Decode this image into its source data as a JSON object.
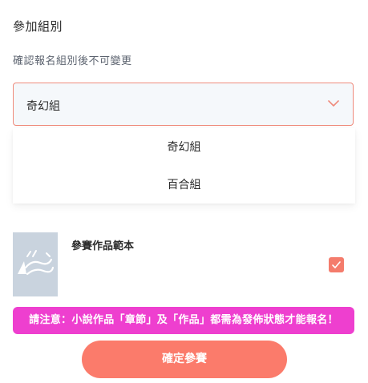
{
  "group_section": {
    "title": "參加組別",
    "note": "確認報名組別後不可變更",
    "selected_value": "奇幻組",
    "options": [
      "奇幻組",
      "百合組"
    ],
    "accent_color": "#ef8a7b",
    "chevron_icon": "chevron-down-icon"
  },
  "work": {
    "title": "參賽作品範本",
    "selected": true,
    "checkbox_color": "#f47c6c",
    "thumbnail_icon": "kadokado-logo"
  },
  "notice": {
    "text": "請注意：小說作品「章節」及「作品」都需為發佈狀態才能報名！",
    "color": "#ee3fcf"
  },
  "confirm_button": {
    "label": "確定參賽",
    "color": "#fb7b6b"
  }
}
